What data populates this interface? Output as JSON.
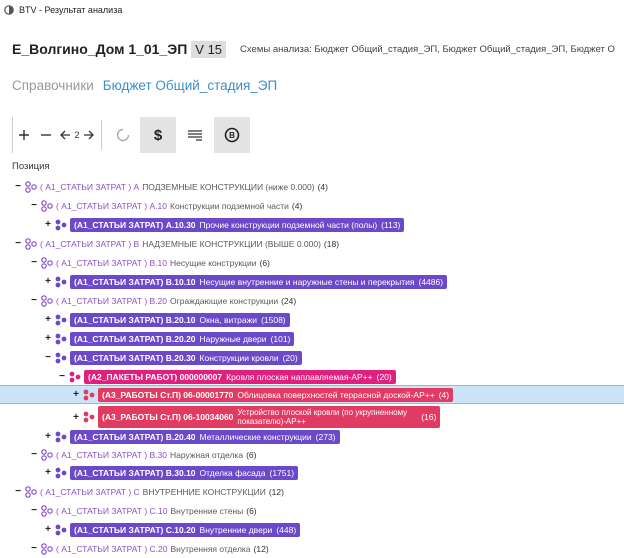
{
  "window": {
    "title": "BTV - Результат анализа"
  },
  "header": {
    "project": "Е_Волгино_Дом 1_01_ЭП",
    "version": "V 15",
    "schemes": "Схемы анализа: Бюджет Общий_стадия_ЭП, Бюджет Общий_стадия_ЭП, Бюджет О"
  },
  "breadcrumbs": {
    "reference": "Справочники",
    "current": "Бюджет Общий_стадия_ЭП"
  },
  "toolbar": {
    "level": "2"
  },
  "column_header": "Позиция",
  "colors": {
    "purple": "#6b49c8",
    "pink": "#e0207f",
    "red": "#e23b63",
    "selected": "#cce4f7",
    "link": "#3d8fc8"
  },
  "tree": [
    {
      "toggle": "−",
      "style": "plain",
      "icon": "hierarchy-icon",
      "code": "( А1_СТАТЬИ ЗАТРАТ ) A",
      "name": "ПОДЗЕМНЫЕ КОНСТРУКЦИИ (ниже 0.000)",
      "count": "(4)"
    },
    {
      "toggle": "−",
      "style": "plain",
      "icon": "hierarchy-icon",
      "code": "( А1_СТАТЬИ ЗАТРАТ ) A.10",
      "name": "Конструкции подземной части",
      "count": "(4)"
    },
    {
      "toggle": "+",
      "style": "purple",
      "icon": "hierarchy-icon",
      "code": "(А1_СТАТЬИ ЗАТРАТ) A.10.30",
      "name": "Прочие конструкции подземной части (полы)",
      "count": "(113)"
    },
    {
      "toggle": "−",
      "style": "plain",
      "icon": "hierarchy-icon",
      "code": "( А1_СТАТЬИ ЗАТРАТ ) B",
      "name": "НАДЗЕМНЫЕ КОНСТРУКЦИИ (ВЫШЕ 0.000)",
      "count": "(18)"
    },
    {
      "toggle": "−",
      "style": "plain",
      "icon": "hierarchy-icon",
      "code": "( А1_СТАТЬИ ЗАТРАТ ) B.10",
      "name": "Несущие конструкции",
      "count": "(6)"
    },
    {
      "toggle": "+",
      "style": "purple",
      "icon": "hierarchy-icon",
      "code": "(А1_СТАТЬИ ЗАТРАТ) B.10.10",
      "name": "Несущие внутренние и наружные стены и перекрытия",
      "count": "(4486)"
    },
    {
      "toggle": "−",
      "style": "plain",
      "icon": "hierarchy-icon",
      "code": "( А1_СТАТЬИ ЗАТРАТ ) B.20",
      "name": "Ограждающие конструкции",
      "count": "(24)"
    },
    {
      "toggle": "+",
      "style": "purple",
      "icon": "hierarchy-icon",
      "code": "(А1_СТАТЬИ ЗАТРАТ) B.20.10",
      "name": "Окна, витражи",
      "count": "(1508)"
    },
    {
      "toggle": "+",
      "style": "purple",
      "icon": "hierarchy-icon",
      "code": "(А1_СТАТЬИ ЗАТРАТ) B.20.20",
      "name": "Наружные двери",
      "count": "(101)"
    },
    {
      "toggle": "−",
      "style": "purple",
      "icon": "hierarchy-icon",
      "code": "(А1_СТАТЬИ ЗАТРАТ) B.20.30",
      "name": "Конструкции кровли",
      "count": "(20)"
    },
    {
      "toggle": "−",
      "style": "pink",
      "icon": "hierarchy-icon",
      "code": "(А2_ПАКЕТЫ РАБОТ) 000000007",
      "name": "Кровля плоская наплавляемая-АР++",
      "count": "(20)"
    },
    {
      "toggle": "+",
      "style": "red",
      "icon": "hierarchy-icon",
      "code": "(А3_РАБОТЫ Ст.П) 06-00001770",
      "name": "Облицовка поверхностей террасной доской-АР++",
      "count": "(4)",
      "selected": true
    },
    {
      "toggle": "+",
      "style": "red",
      "icon": "hierarchy-icon",
      "code": "(А3_РАБОТЫ Ст.П) 06-10034060",
      "name_line1": "Устройство плоской кровли (по укрупненному",
      "name_line2": "показателю)-АР++",
      "count": "(16)"
    },
    {
      "toggle": "+",
      "style": "purple",
      "icon": "hierarchy-icon",
      "code": "(А1_СТАТЬИ ЗАТРАТ) B.20.40",
      "name": "Металлические конструкции",
      "count": "(273)"
    },
    {
      "toggle": "−",
      "style": "plain",
      "icon": "hierarchy-icon",
      "code": "( А1_СТАТЬИ ЗАТРАТ ) B.30",
      "name": "Наружная отделка",
      "count": "(6)"
    },
    {
      "toggle": "+",
      "style": "purple",
      "icon": "hierarchy-icon",
      "code": "(А1_СТАТЬИ ЗАТРАТ) B.30.10",
      "name": "Отделка фасада",
      "count": "(1751)"
    },
    {
      "toggle": "−",
      "style": "plain",
      "icon": "hierarchy-icon",
      "code": "( А1_СТАТЬИ ЗАТРАТ ) C",
      "name": "ВНУТРЕННИЕ КОНСТРУКЦИИ",
      "count": "(12)"
    },
    {
      "toggle": "−",
      "style": "plain",
      "icon": "hierarchy-icon",
      "code": "( А1_СТАТЬИ ЗАТРАТ ) C.10",
      "name": "Внутренние стены",
      "count": "(6)"
    },
    {
      "toggle": "+",
      "style": "purple",
      "icon": "hierarchy-icon",
      "code": "(А1_СТАТЬИ ЗАТРАТ) C.10.20",
      "name": "Внутренние двери",
      "count": "(448)"
    },
    {
      "toggle": "−",
      "style": "plain",
      "icon": "hierarchy-icon",
      "code": "( А1_СТАТЬИ ЗАТРАТ ) C.20",
      "name": "Внутренняя отделка",
      "count": "(12)"
    }
  ]
}
